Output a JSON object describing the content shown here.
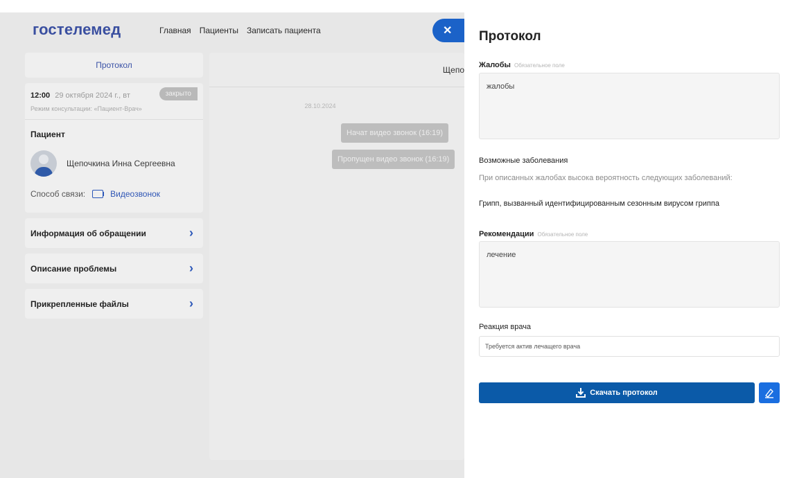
{
  "app": {
    "logo": "гостелемед",
    "nav": [
      "Главная",
      "Пациенты",
      "Записать пациента"
    ],
    "close_icon": "close-icon"
  },
  "left": {
    "protocol_tab": "Протокол",
    "consult": {
      "time": "12:00",
      "date": "29 октября 2024 г., вт",
      "status": "закрыто",
      "mode": "Режим консультации: «Пациент-Врач»"
    },
    "patient": {
      "title": "Пациент",
      "name": "Щепочкина Инна Сергеевна",
      "contact_label": "Способ связи:",
      "contact_value": "Видеозвонок"
    },
    "menu": [
      {
        "label": "Информация об обращении"
      },
      {
        "label": "Описание проблемы"
      },
      {
        "label": "Прикрепленные файлы"
      }
    ]
  },
  "chat": {
    "header": "Щепо",
    "date": "28.10.2024",
    "messages": [
      "Начат видео звонок (16:19)",
      "Пропущен видео звонок (16:19)"
    ]
  },
  "panel": {
    "title": "Протокол",
    "complaints_label": "Жалобы",
    "required_note": "Обязательное поле",
    "complaints_value": "жалобы",
    "diseases_title": "Возможные заболевания",
    "diseases_intro": "При описанных жалобах высока вероятность следующих заболеваний:",
    "disease_item": "Грипп, вызванный идентифицированным сезонным вирусом гриппа",
    "recommendations_label": "Рекомендации",
    "recommendations_value": "лечение",
    "reaction_label": "Реакция врача",
    "reaction_value": "Требуется актив лечащего врача",
    "download_label": "Скачать протокол"
  },
  "colors": {
    "brand_blue": "#0b5aa8",
    "accent_blue": "#1b62c8",
    "logo_blue": "#3a4fa0"
  }
}
